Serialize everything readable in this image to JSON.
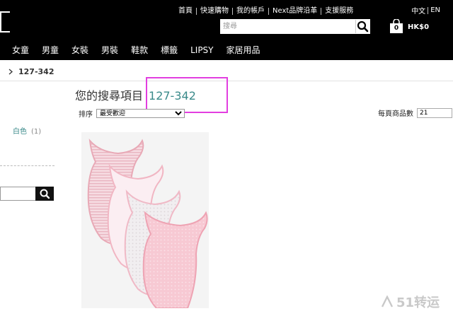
{
  "header": {
    "top_links": [
      "首頁",
      "快速購物",
      "我的帳戶",
      "Next品牌沿革",
      "支援服務"
    ],
    "lang": {
      "zh": "中文",
      "en": "EN"
    },
    "search_placeholder": "搜尋",
    "cart": {
      "count": "0",
      "total": "HK$0"
    },
    "nav": [
      "女童",
      "男童",
      "女裝",
      "男裝",
      "鞋款",
      "標籤",
      "LIPSY",
      "家居用品"
    ]
  },
  "breadcrumb": {
    "current": "127-342"
  },
  "results": {
    "title_prefix": "您的搜尋項目",
    "term": "127-342",
    "sort_label": "排序",
    "sort_value": "最受歡迎",
    "per_page_label": "每頁商品數",
    "per_page_value": "21"
  },
  "sidebar": {
    "facet_label": "白色",
    "facet_count": "(1)"
  },
  "watermark": {
    "text": "51转运"
  },
  "colors": {
    "header_bg": "#000000",
    "accent": "#3a8a8a",
    "highlight": "#e23ee0"
  },
  "icons": [
    "logo-mark-icon",
    "search-icon",
    "shopping-bag-icon",
    "chevron-right-icon",
    "dropdown-arrow-icon",
    "watermark-logo-icon"
  ]
}
